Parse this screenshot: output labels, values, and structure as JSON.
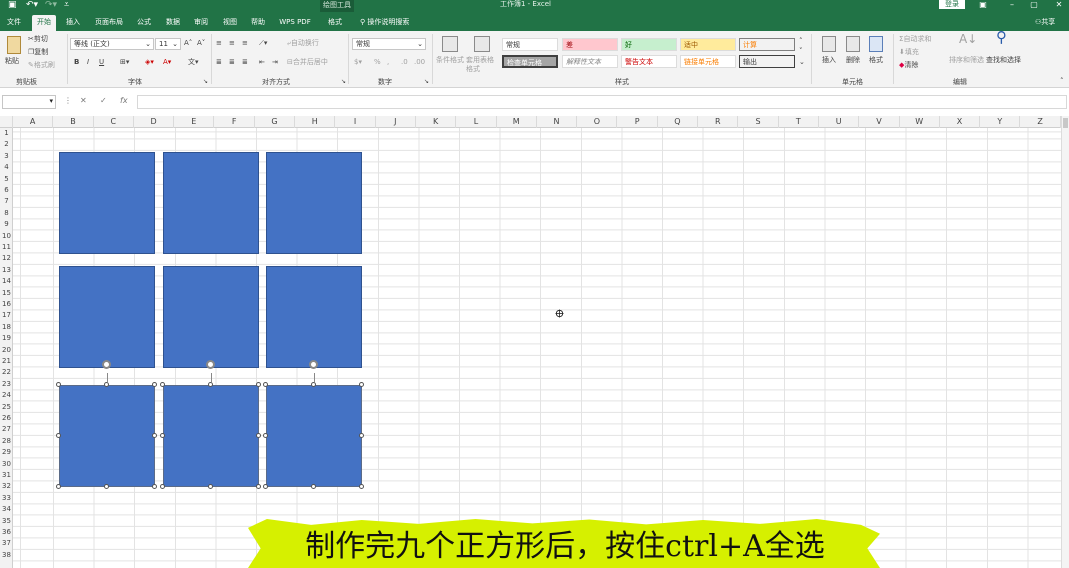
{
  "titlebar": {
    "context_tab": "绘图工具",
    "title": "工作簿1 - Excel",
    "login": "登录"
  },
  "tabs": [
    "文件",
    "开始",
    "插入",
    "页面布局",
    "公式",
    "数据",
    "审阅",
    "视图",
    "帮助",
    "WPS PDF",
    "格式"
  ],
  "active_tab": "开始",
  "search_label": "操作说明搜索",
  "share_label": "共享",
  "ribbon": {
    "clipboard": {
      "paste": "粘贴",
      "cut": "剪切",
      "copy": "复制",
      "format_painter": "格式刷",
      "label": "剪贴板"
    },
    "font": {
      "name": "等线 (正文)",
      "size": "11",
      "bold": "B",
      "italic": "I",
      "underline": "U",
      "label": "字体"
    },
    "alignment": {
      "wrap": "自动换行",
      "merge": "合并后居中",
      "label": "对齐方式"
    },
    "number": {
      "format": "常规",
      "label": "数字"
    },
    "styles": {
      "conditional": "条件格式",
      "table": "套用表格格式",
      "cells": [
        "常规",
        "差",
        "好",
        "适中",
        "计算",
        "检查单元格",
        "解释性文本",
        "警告文本",
        "链接单元格",
        "输出"
      ],
      "label": "样式",
      "colors": {
        "bad": "#ffc7ce",
        "good": "#c6efce",
        "neutral": "#ffeb9c",
        "calc": "#f2f2f2",
        "check": "#a5a5a5"
      }
    },
    "cells_group": {
      "insert": "插入",
      "delete": "删除",
      "format": "格式",
      "label": "单元格"
    },
    "editing": {
      "autosum": "自动求和",
      "fill": "填充",
      "clear": "清除",
      "sort": "排序和筛选",
      "find": "查找和选择",
      "label": "编辑"
    }
  },
  "formula_bar": {
    "cancel": "✕",
    "enter": "✓",
    "fx": "fx",
    "value": ""
  },
  "columns": [
    "A",
    "B",
    "C",
    "D",
    "E",
    "F",
    "G",
    "H",
    "I",
    "J",
    "K",
    "L",
    "M",
    "N",
    "O",
    "P",
    "Q",
    "R",
    "S",
    "T",
    "U",
    "V",
    "W",
    "X",
    "Y",
    "Z"
  ],
  "rows": [
    "1",
    "2",
    "3",
    "4",
    "5",
    "6",
    "7",
    "8",
    "9",
    "10",
    "11",
    "12",
    "13",
    "14",
    "15",
    "16",
    "17",
    "18",
    "19",
    "20",
    "21",
    "22",
    "23",
    "24",
    "25",
    "26",
    "27",
    "28",
    "29",
    "30",
    "31",
    "32",
    "33",
    "34",
    "35",
    "36",
    "37",
    "38"
  ],
  "shape_color": "#4472c4",
  "accent": "#217346",
  "subtitle": "制作完九个正方形后，按住ctrl+A全选",
  "subtitle_bg": "#d6f000"
}
